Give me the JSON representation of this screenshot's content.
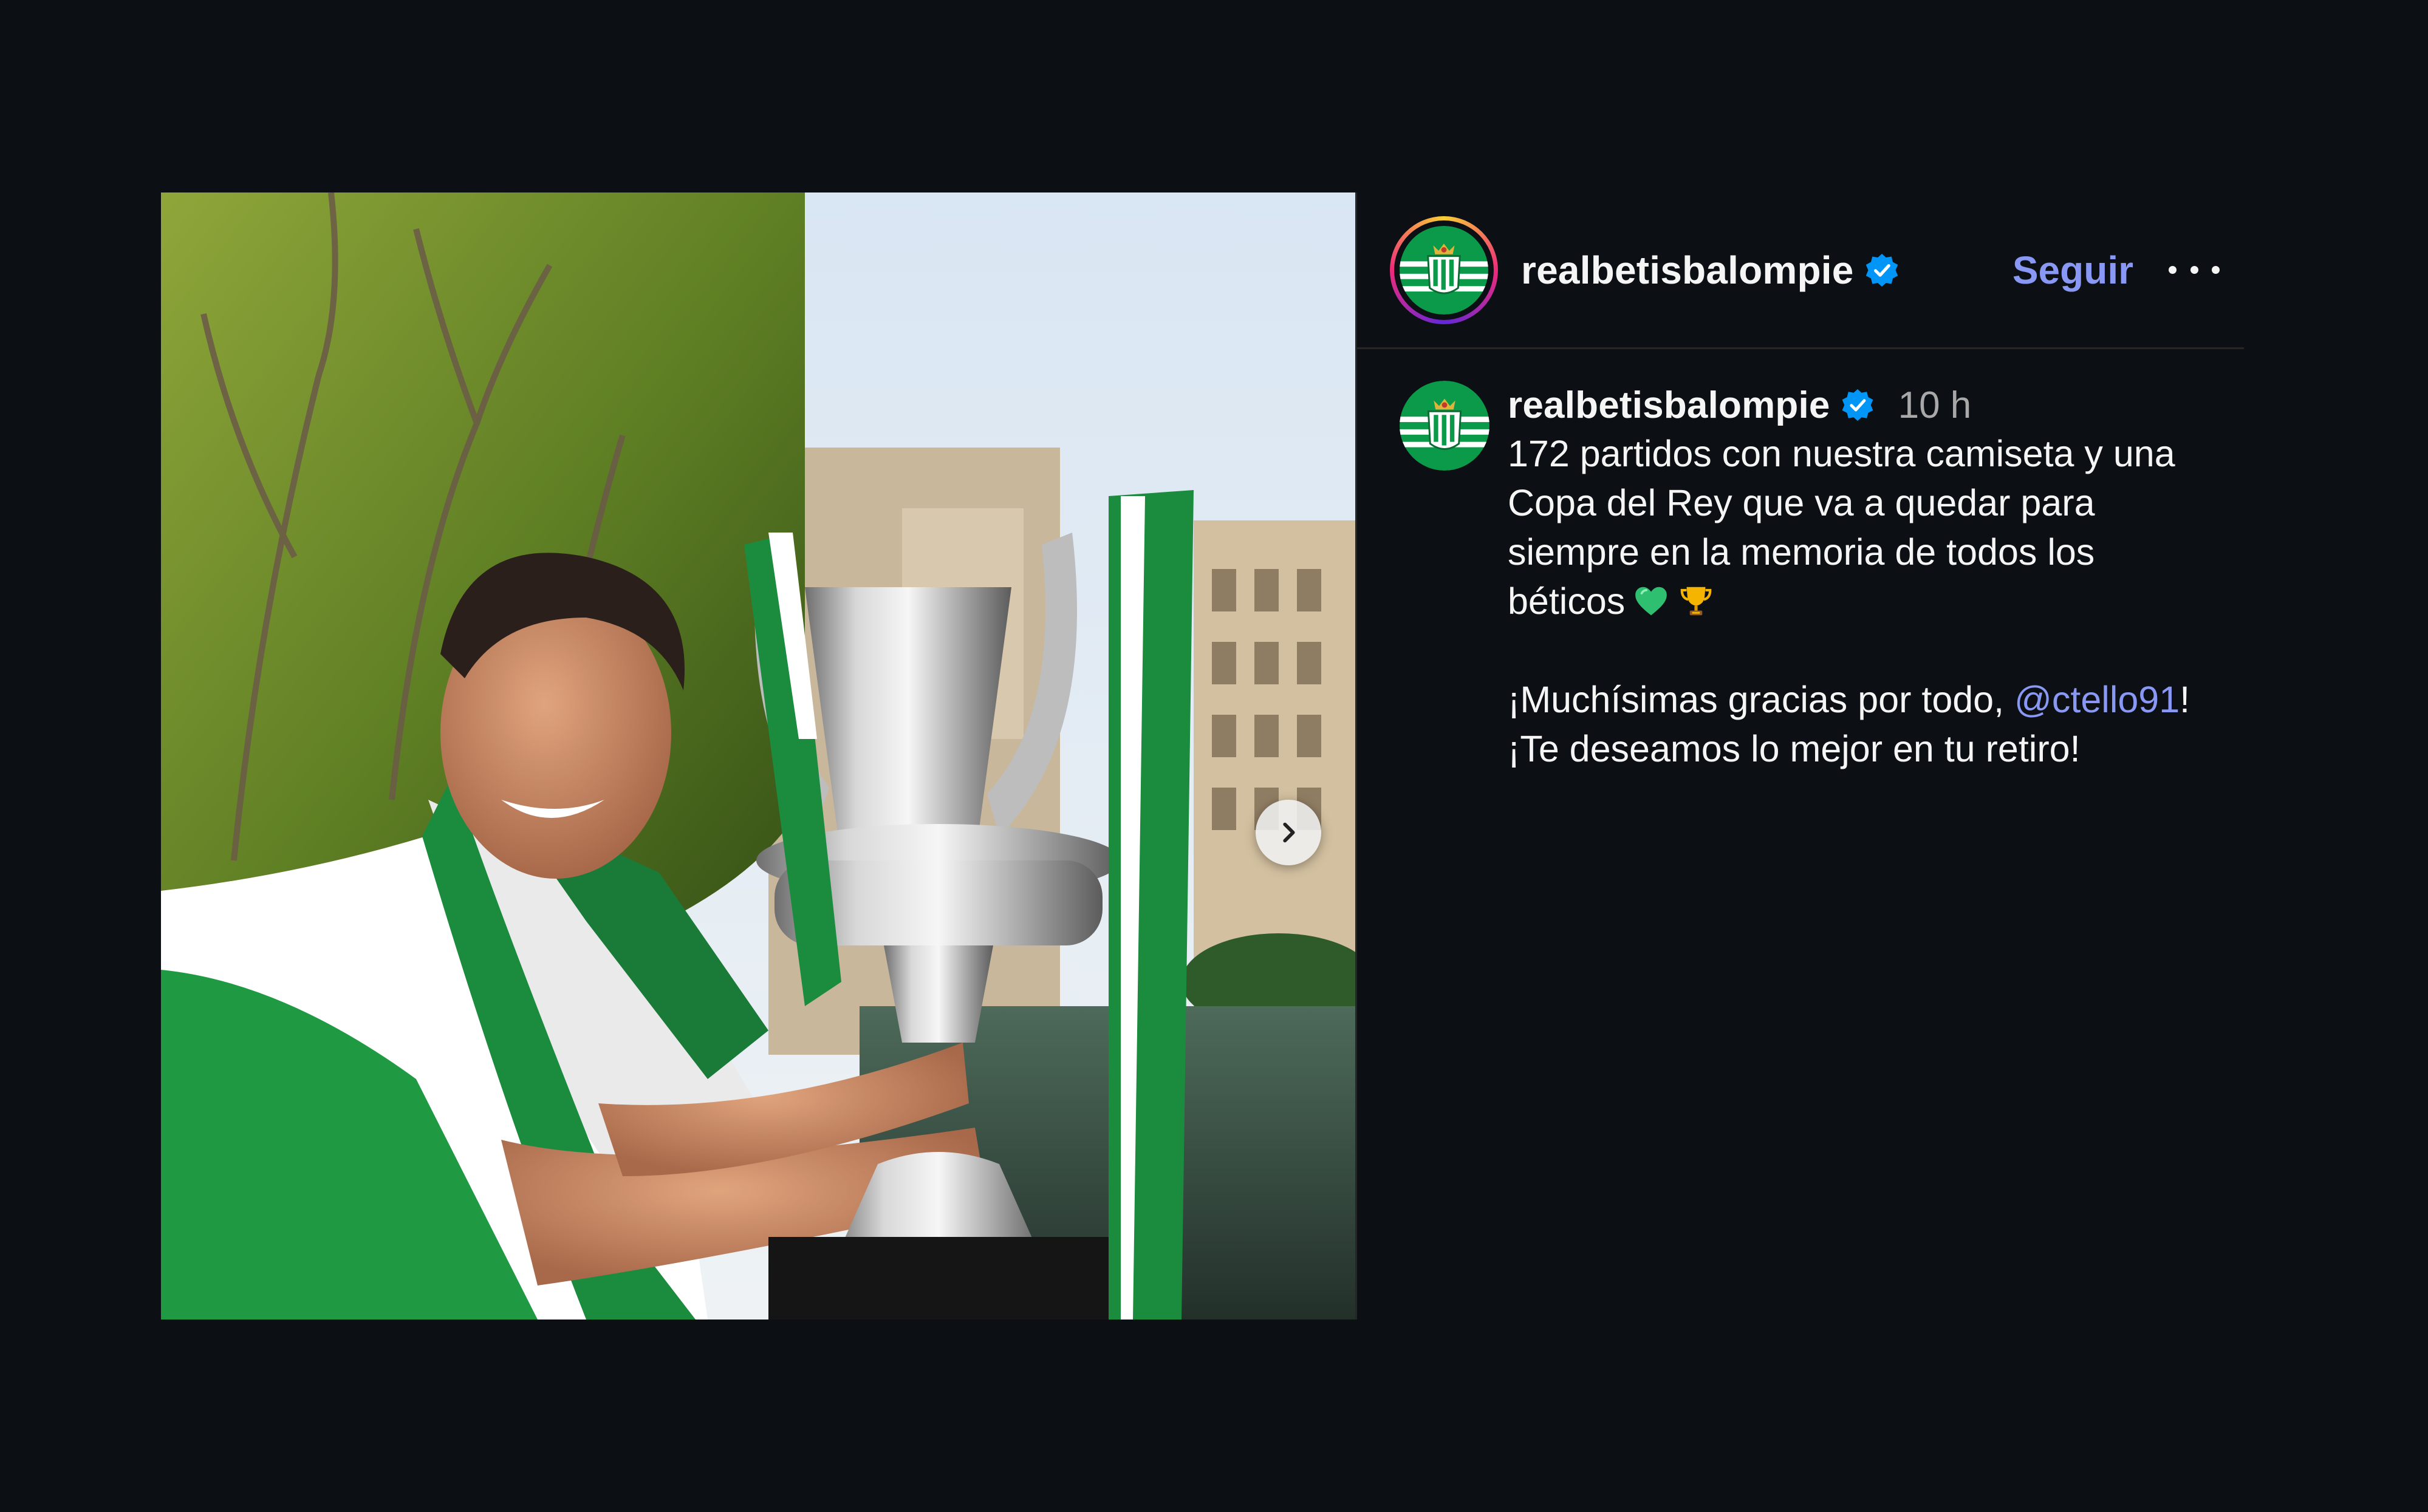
{
  "post": {
    "media": {
      "description_icon": "photo-icon",
      "next_icon": "chevron-right-icon"
    },
    "header": {
      "username": "realbetisbalompie",
      "verified_icon": "verified-badge-icon",
      "follow_label": "Seguir",
      "more_icon": "more-options-icon"
    },
    "caption": {
      "username": "realbetisbalompie",
      "time": "10 h",
      "line1": "172 partidos con nuestra camiseta y una Copa del Rey que va a quedar para siempre en la memoria de todos los béticos",
      "emoji1": "green-heart-icon",
      "emoji2": "trophy-icon",
      "line2_prefix": "¡Muchísimas gracias por todo, ",
      "mention": "@ctello91",
      "line2_suffix": "!",
      "line3": "¡Te deseamos lo mejor en tu retiro!"
    }
  },
  "colors": {
    "background": "#0c1014",
    "link": "#8a98f5",
    "verified": "#0095f6",
    "muted": "#a8a8a8",
    "betis_green": "#0bb363"
  }
}
